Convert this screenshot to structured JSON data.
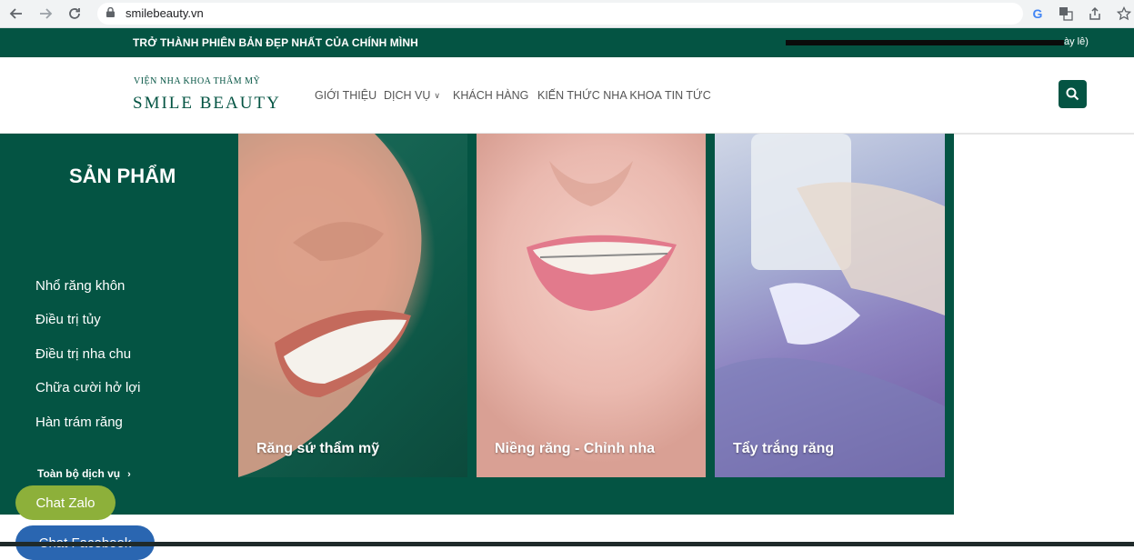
{
  "browser": {
    "url": "smilebeauty.vn",
    "icons": [
      "back-icon",
      "forward-icon",
      "reload-icon",
      "lock-icon",
      "google-icon",
      "translate-icon",
      "share-icon",
      "star-icon"
    ]
  },
  "topbar": {
    "slogan": "TRỞ THÀNH PHIÊN BẢN ĐẸP NHẤT CỦA CHÍNH MÌNH",
    "marquee": "ày lễ)"
  },
  "header": {
    "logo_small": "VIỆN NHA KHOA THẨM MỸ",
    "logo_big": "SMILE BEAUTY",
    "menu": [
      {
        "label": "GIỚI THIỆU"
      },
      {
        "label": "DỊCH VỤ"
      },
      {
        "label": "KHÁCH HÀNG"
      },
      {
        "label": "KIẾN THỨC NHA KHOA"
      },
      {
        "label": "TIN TỨC"
      }
    ]
  },
  "panel": {
    "title": "SẢN PHẨM",
    "services": [
      "Nhổ răng khôn",
      "Điều trị tủy",
      "Điều trị nha chu",
      "Chữa cười hở lợi",
      "Hàn trám răng"
    ],
    "all_services": "Toàn bộ dịch vụ",
    "cards": [
      {
        "label": "Răng sứ thẩm mỹ"
      },
      {
        "label": "Niềng răng - Chỉnh nha"
      },
      {
        "label": "Tẩy trắng răng"
      }
    ]
  },
  "floating": {
    "zalo": "Chat Zalo",
    "facebook": "Chat Facebook"
  },
  "colors": {
    "brand_green": "#045443",
    "zalo_green": "#8db03a",
    "facebook_blue": "#2a66b1"
  }
}
